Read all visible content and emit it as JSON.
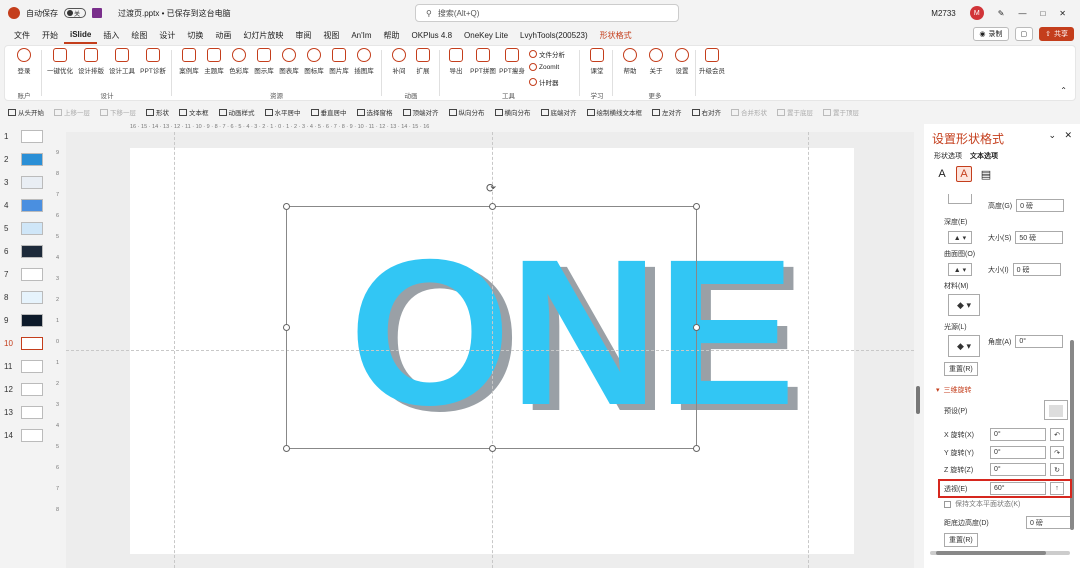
{
  "titlebar": {
    "autosave_label": "自动保存",
    "autosave_state": "关",
    "filename": "过渡页.pptx • 已保存到这台电脑",
    "search_placeholder": "搜索(Alt+Q)",
    "user_code": "M2733",
    "user_initial": "M"
  },
  "menu": {
    "tabs": [
      "文件",
      "开始",
      "iSlide",
      "插入",
      "绘图",
      "设计",
      "切换",
      "动画",
      "幻灯片放映",
      "审阅",
      "视图",
      "An'Im",
      "帮助",
      "OKPlus 4.8",
      "OneKey Lite",
      "LvyhTools(200523)",
      "形状格式"
    ],
    "record_label": "录制",
    "share_label": "共享"
  },
  "ribbon": {
    "buttons": [
      "登录",
      "一键优化",
      "设计排版",
      "设计工具",
      "PPT诊断",
      "案例库",
      "主题库",
      "色彩库",
      "图示库",
      "图表库",
      "图标库",
      "图片库",
      "插图库",
      "补间",
      "扩展",
      "导出",
      "PPT拼图",
      "PPT瘦身",
      "课堂",
      "帮助",
      "关于",
      "设置",
      "升级会员"
    ],
    "small_items": [
      "文件分析",
      "ZoomIt",
      "计时器"
    ],
    "groups": [
      "账户",
      "设计",
      "资源",
      "动画",
      "工具",
      "学习",
      "更多"
    ]
  },
  "toolbar2": {
    "items": [
      "从头开始",
      "上移一层",
      "下移一层",
      "形状",
      "文本框",
      "动画样式",
      "水平居中",
      "垂直居中",
      "选择窗格",
      "顶端对齐",
      "纵向分布",
      "横向分布",
      "底端对齐",
      "绘制横线文本框",
      "左对齐",
      "右对齐",
      "合并形状",
      "置于底层",
      "置于顶层"
    ],
    "disabled": [
      false,
      true,
      true,
      false,
      false,
      false,
      false,
      false,
      false,
      false,
      false,
      false,
      false,
      false,
      false,
      false,
      true,
      true,
      true
    ]
  },
  "thumbnails": {
    "numbers": [
      "1",
      "2",
      "3",
      "4",
      "5",
      "6",
      "7",
      "8",
      "9",
      "10",
      "11",
      "12",
      "13",
      "14"
    ],
    "selected": "10"
  },
  "ruler": {
    "horizontal": "16 · 15 · 14 · 13 · 12 · 11 · 10 · 9 · 8 · 7 · 6 · 5 · 4 · 3 · 2 · 1 · 0 · 1 · 2 · 3 · 4 · 5 · 6 · 7 · 8 · 9 · 10 · 11 · 12 · 13 · 14 · 15 · 16",
    "vertical": [
      "9",
      "8",
      "7",
      "6",
      "5",
      "4",
      "3",
      "2",
      "1",
      "0",
      "1",
      "2",
      "3",
      "4",
      "5",
      "6",
      "7",
      "8",
      "9"
    ]
  },
  "slide": {
    "text": "ONE",
    "text_color": "#32c6f4"
  },
  "panel": {
    "title": "设置形状格式",
    "tab_shape": "形状选项",
    "tab_text": "文本选项",
    "height_label": "高度(G)",
    "height_value": "0 磅",
    "depth_label": "深度(E)",
    "depth_size_label": "大小(S)",
    "depth_size_value": "50 磅",
    "contour_label": "曲面图(O)",
    "contour_size_label": "大小(I)",
    "contour_size_value": "0 磅",
    "material_label": "材料(M)",
    "lighting_label": "光源(L)",
    "angle_label": "角度(A)",
    "angle_value": "0°",
    "reset1_label": "重置(R)",
    "section_3d_rotation": "三维旋转",
    "preset_label": "预设(P)",
    "x_label": "X 旋转(X)",
    "x_value": "0°",
    "y_label": "Y 旋转(Y)",
    "y_value": "0°",
    "z_label": "Z 旋转(Z)",
    "z_value": "0°",
    "perspective_label": "透视(E)",
    "perspective_value": "60°",
    "keep_flat_label": "保持文本平面状态(K)",
    "distance_label": "距底边高度(D)",
    "distance_value": "0 磅",
    "reset2_label": "重置(R)"
  }
}
